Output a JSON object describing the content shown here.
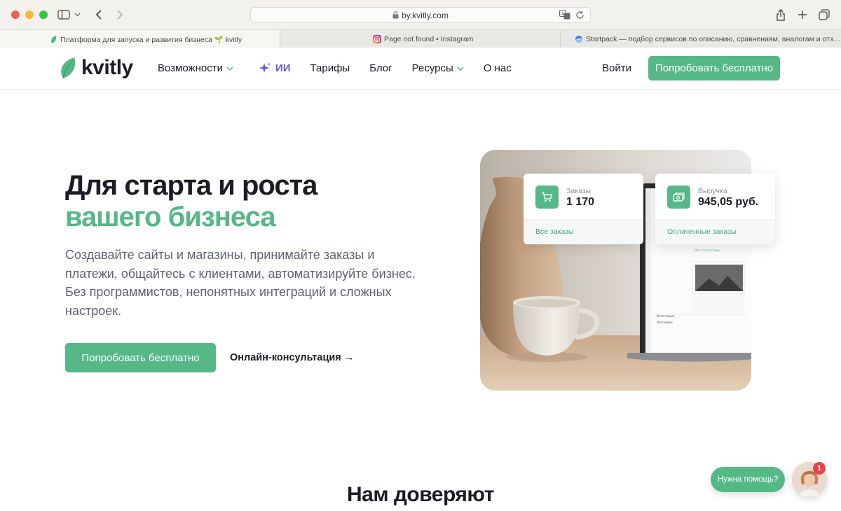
{
  "browser": {
    "url": "by.kvitly.com",
    "tabs": [
      {
        "title": "Платформа для запуска и развития бизнеса 🌱 kvitly",
        "active": true
      },
      {
        "title": "Page not found • Instagram",
        "active": false
      },
      {
        "title": "Startpack — подбор сервисов по описанию, сравнениям, аналогам и отзыв...",
        "active": false
      }
    ]
  },
  "header": {
    "logo": "kvitly",
    "nav": [
      {
        "label": "Возможности",
        "has_dropdown": true
      },
      {
        "label": "ИИ",
        "icon": "sparkle-icon"
      },
      {
        "label": "Тарифы"
      },
      {
        "label": "Блог"
      },
      {
        "label": "Ресурсы",
        "has_dropdown": true
      },
      {
        "label": "О нас"
      }
    ],
    "login_label": "Войти",
    "cta_label": "Попробовать бесплатно"
  },
  "hero": {
    "title_line1": "Для старта и роста",
    "title_line2": "вашего бизнеса",
    "description": "Создавайте сайты и магазины, принимайте заказы и платежи, общайтесь с клиентами, автоматизируйте бизнес. Без программистов, непонятных интеграций и сложных настроек.",
    "cta_label": "Попробовать бесплатно",
    "consult_label": "Онлайн-консультация →"
  },
  "stats": {
    "orders": {
      "label": "Заказы",
      "value": "1 170",
      "link": "Все заказы",
      "icon": "cart-icon"
    },
    "revenue": {
      "label": "Выручка",
      "value": "945,05 руб.",
      "link": "Оплаченные заказы",
      "icon": "money-icon"
    }
  },
  "trust": {
    "title": "Нам доверяют"
  },
  "help": {
    "label": "Нужна помощь?",
    "badge": "1"
  },
  "colors": {
    "brand_green": "#55b886",
    "ai_purple": "#6658d6",
    "text_dark": "#1a1d24"
  }
}
